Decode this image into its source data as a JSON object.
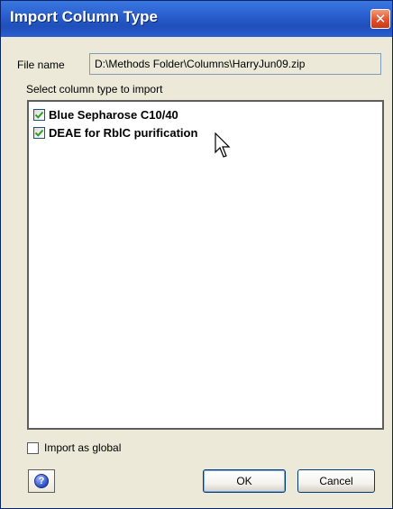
{
  "window": {
    "title": "Import Column Type",
    "close_glyph": "✕"
  },
  "file": {
    "label": "File name",
    "value": "D:\\Methods Folder\\Columns\\HarryJun09.zip"
  },
  "list": {
    "label": "Select column type to import",
    "items": [
      {
        "label": "Blue Sepharose C10/40",
        "checked": true
      },
      {
        "label": "DEAE for RblC purification",
        "checked": true
      }
    ]
  },
  "options": {
    "import_global_label": "Import as global",
    "import_global_checked": false
  },
  "buttons": {
    "help_glyph": "?",
    "ok_label": "OK",
    "cancel_label": "Cancel"
  },
  "colors": {
    "titlebar": "#2b5fcf",
    "close": "#e0512b",
    "check": "#2e9e2e"
  },
  "icons": {
    "close": "close-icon",
    "check": "checkmark-icon",
    "help": "help-icon",
    "cursor": "mouse-pointer-icon"
  }
}
